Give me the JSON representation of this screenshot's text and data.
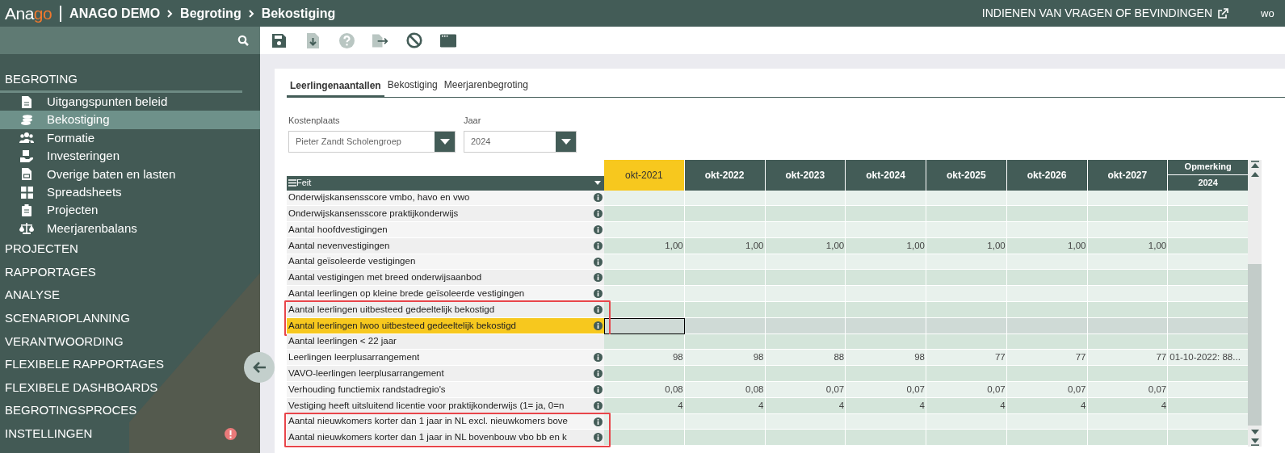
{
  "header": {
    "logo": [
      "Ana",
      "go"
    ],
    "breadcrumb": [
      "ANAGO DEMO",
      "Begroting",
      "Bekostiging"
    ],
    "feedback_link": "INDIENEN VAN VRAGEN OF BEVINDINGEN",
    "user": "wo"
  },
  "sidebar": {
    "sections": [
      {
        "label": "BEGROTING",
        "expanded": true,
        "alert": false,
        "children": [
          {
            "label": "Uitgangspunten beleid",
            "selected": false
          },
          {
            "label": "Bekostiging",
            "selected": true
          },
          {
            "label": "Formatie",
            "selected": false
          },
          {
            "label": "Investeringen",
            "selected": false
          },
          {
            "label": "Overige baten en lasten",
            "selected": false
          },
          {
            "label": "Spreadsheets",
            "selected": false
          },
          {
            "label": "Projecten",
            "selected": false
          },
          {
            "label": "Meerjarenbalans",
            "selected": false
          }
        ]
      },
      {
        "label": "PROJECTEN",
        "expanded": false,
        "alert": false
      },
      {
        "label": "RAPPORTAGES",
        "expanded": false,
        "alert": false
      },
      {
        "label": "ANALYSE",
        "expanded": false,
        "alert": false
      },
      {
        "label": "SCENARIOPLANNING",
        "expanded": false,
        "alert": false
      },
      {
        "label": "VERANTWOORDING",
        "expanded": false,
        "alert": false
      },
      {
        "label": "FLEXIBELE RAPPORTAGES",
        "expanded": false,
        "alert": false
      },
      {
        "label": "FLEXIBELE DASHBOARDS",
        "expanded": false,
        "alert": false
      },
      {
        "label": "BEGROTINGSPROCES",
        "expanded": false,
        "alert": false
      },
      {
        "label": "INSTELLINGEN",
        "expanded": false,
        "alert": true
      }
    ]
  },
  "tabs": [
    {
      "label": "Leerlingenaantallen",
      "selected": true
    },
    {
      "label": "Bekostiging",
      "selected": false
    },
    {
      "label": "Meerjarenbegroting",
      "selected": false
    }
  ],
  "filters": [
    {
      "label": "Kostenplaats",
      "value": "Pieter Zandt Scholengroep"
    },
    {
      "label": "Jaar",
      "value": "2024"
    }
  ],
  "table": {
    "label_column": "Feit",
    "columns": [
      {
        "label": "okt-2021",
        "selected": true
      },
      {
        "label": "okt-2022",
        "selected": false
      },
      {
        "label": "okt-2023",
        "selected": false
      },
      {
        "label": "okt-2024",
        "selected": false
      },
      {
        "label": "okt-2025",
        "selected": false
      },
      {
        "label": "okt-2026",
        "selected": false
      },
      {
        "label": "okt-2027",
        "selected": false
      }
    ],
    "remark_column": {
      "label": "Opmerking",
      "sublabel": "2024"
    },
    "rows": [
      {
        "label": "Onderwijskansensscore vmbo, havo en vwo",
        "info": true,
        "selected": false,
        "marked": false
      },
      {
        "label": "Onderwijskansensscore praktijkonderwijs",
        "info": true,
        "selected": false,
        "marked": false
      },
      {
        "label": "Aantal hoofdvestigingen",
        "info": true,
        "selected": false,
        "marked": false
      },
      {
        "label": "Aantal nevenvestigingen",
        "info": true,
        "selected": false,
        "marked": false,
        "values": [
          "1,00",
          "1,00",
          "1,00",
          "1,00",
          "1,00",
          "1,00",
          "1,00"
        ]
      },
      {
        "label": "Aantal geïsoleerde vestigingen",
        "info": true,
        "selected": false,
        "marked": false
      },
      {
        "label": "Aantal vestigingen met breed onderwijsaanbod",
        "info": true,
        "selected": false,
        "marked": false
      },
      {
        "label": "Aantal leerlingen op kleine brede geïsoleerde vestigingen",
        "info": true,
        "selected": false,
        "marked": false
      },
      {
        "label": "Aantal leerlingen uitbesteed gedeeltelijk bekostigd",
        "info": true,
        "selected": false,
        "marked": true
      },
      {
        "label": "Aantal leerlingen lwoo uitbesteed gedeeltelijk bekostigd",
        "info": true,
        "selected": true,
        "marked": true
      },
      {
        "label": "Aantal leerlingen < 22 jaar",
        "info": false,
        "selected": false,
        "marked": false
      },
      {
        "label": "Leerlingen leerplusarrangement",
        "info": true,
        "selected": false,
        "marked": false,
        "values": [
          "98",
          "98",
          "88",
          "98",
          "77",
          "77",
          "77"
        ],
        "remark": "01-10-2022: 88..."
      },
      {
        "label": "VAVO-leerlingen leerplusarrangement",
        "info": true,
        "selected": false,
        "marked": false
      },
      {
        "label": "Verhouding functiemix randstadregio's",
        "info": true,
        "selected": false,
        "marked": false,
        "values": [
          "0,08",
          "0,08",
          "0,07",
          "0,07",
          "0,07",
          "0,07",
          "0,07"
        ]
      },
      {
        "label": "Vestiging heeft uitsluitend licentie voor praktijkonderwijs (1= ja, 0=n",
        "info": true,
        "selected": false,
        "marked": false,
        "values": [
          "4",
          "4",
          "4",
          "4",
          "4",
          "4",
          "4"
        ]
      },
      {
        "label": "Aantal nieuwkomers korter dan 1 jaar in NL excl. nieuwkomers bove",
        "info": true,
        "selected": false,
        "marked": true
      },
      {
        "label": "Aantal nieuwkomers korter dan 1 jaar in NL bovenbouw vbo bb en k",
        "info": true,
        "selected": false,
        "marked": true
      }
    ]
  }
}
